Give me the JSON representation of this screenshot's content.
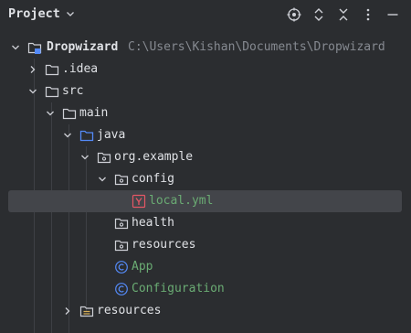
{
  "header": {
    "title": "Project",
    "tools": [
      "locate-icon",
      "expand-all-icon",
      "collapse-all-icon",
      "more-options-icon",
      "hide-icon"
    ]
  },
  "tree": [
    {
      "label": "Dropwizard",
      "path": "C:\\Users\\Kishan\\Documents\\Dropwizard",
      "icon": "module-folder-icon",
      "expanded": true,
      "depth": 0
    },
    {
      "label": ".idea",
      "icon": "folder-icon",
      "expanded": false,
      "depth": 1
    },
    {
      "label": "src",
      "icon": "folder-icon",
      "expanded": true,
      "depth": 1
    },
    {
      "label": "main",
      "icon": "folder-icon",
      "expanded": true,
      "depth": 2
    },
    {
      "label": "java",
      "icon": "source-folder-icon",
      "expanded": true,
      "depth": 3
    },
    {
      "label": "org.example",
      "icon": "package-icon",
      "expanded": true,
      "depth": 4
    },
    {
      "label": "config",
      "icon": "package-icon",
      "expanded": true,
      "depth": 5
    },
    {
      "label": "local.yml",
      "icon": "yaml-file-icon",
      "depth": 6,
      "selected": true
    },
    {
      "label": "health",
      "icon": "package-icon",
      "depth": 5
    },
    {
      "label": "resources",
      "icon": "package-icon",
      "depth": 5
    },
    {
      "label": "App",
      "icon": "class-icon",
      "depth": 5
    },
    {
      "label": "Configuration",
      "icon": "class-icon",
      "depth": 5
    },
    {
      "label": "resources",
      "icon": "resources-folder-icon",
      "expanded": false,
      "depth": 3
    }
  ],
  "colors": {
    "background": "#2b2d30",
    "text": "#dfe1e5",
    "path": "#868a91",
    "vcs_added": "#6aab73",
    "folder_stroke": "#ced0d6",
    "source_folder": "#548af7",
    "class_icon": "#548af7",
    "yaml_icon": "#e55765",
    "selection": "#43454a"
  }
}
